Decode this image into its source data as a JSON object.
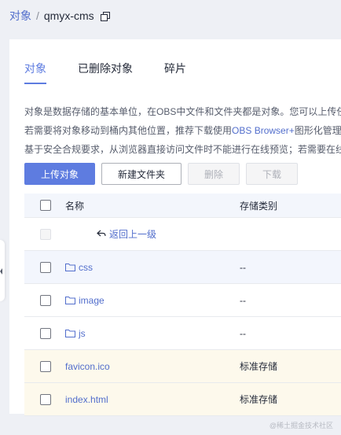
{
  "breadcrumb": {
    "root": "对象",
    "separator": "/",
    "current": "qmyx-cms"
  },
  "tabs": [
    {
      "label": "对象",
      "active": true
    },
    {
      "label": "已删除对象",
      "active": false
    },
    {
      "label": "碎片",
      "active": false
    }
  ],
  "description": {
    "line1": "对象是数据存储的基本单位，在OBS中文件和文件夹都是对象。您可以上传任",
    "line2_pre": "若需要将对象移动到桶内其他位置，推荐下载使用",
    "line2_link": "OBS Browser+",
    "line2_post": "图形化管理",
    "line3": "基于安全合规要求，从浏览器直接访问文件时不能进行在线预览；若需要在线"
  },
  "toolbar": {
    "upload": "上传对象",
    "new_folder": "新建文件夹",
    "delete": "删除",
    "download": "下载"
  },
  "table": {
    "columns": {
      "name": "名称",
      "storage": "存储类别"
    },
    "back_label": "返回上一级",
    "rows": [
      {
        "name": "css",
        "storage": "--",
        "kind": "folder"
      },
      {
        "name": "image",
        "storage": "--",
        "kind": "folder"
      },
      {
        "name": "js",
        "storage": "--",
        "kind": "folder"
      },
      {
        "name": "favicon.ico",
        "storage": "标准存储",
        "kind": "file"
      },
      {
        "name": "index.html",
        "storage": "标准存储",
        "kind": "file"
      }
    ]
  },
  "watermark": "@稀土掘金技术社区",
  "colors": {
    "accent": "#5e7ce0",
    "link": "#526ecc"
  }
}
